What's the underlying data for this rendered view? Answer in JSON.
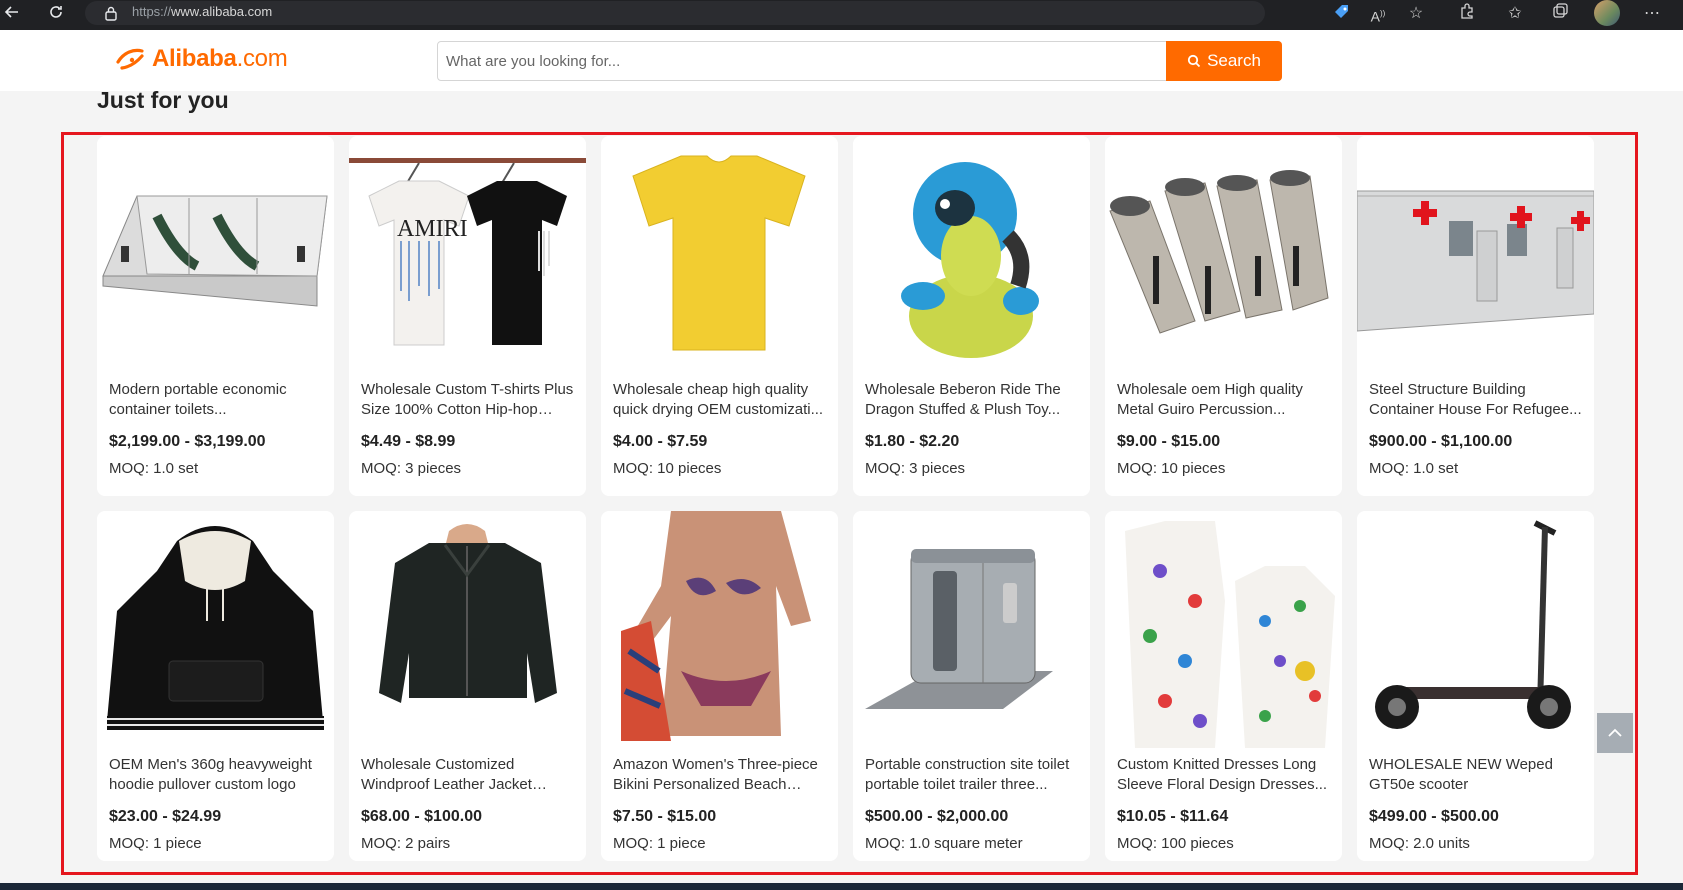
{
  "browser": {
    "url_scheme": "https://",
    "url_host": "www.alibaba.com",
    "icons": [
      "back-icon",
      "reload-icon",
      "lock-icon",
      "tag-icon",
      "read-aloud-icon",
      "favorite-add-icon",
      "extensions-icon",
      "favorites-icon",
      "collections-icon",
      "profile-avatar",
      "more-icon"
    ]
  },
  "header": {
    "logo_text": "Alibaba",
    "logo_suffix": ".com",
    "search_placeholder": "What are you looking for...",
    "search_button": "Search"
  },
  "section": {
    "title": "Just for you"
  },
  "colors": {
    "brand": "#ff6a00",
    "highlight": "#e5161e"
  },
  "products": [
    {
      "title": "Modern portable economic container toilets...",
      "price": "$2,199.00 - $3,199.00",
      "moq": "MOQ: 1.0 set",
      "icon": "container-toilet-image"
    },
    {
      "title": "Wholesale Custom T-shirts Plus Size 100% Cotton Hip-hop Stre...",
      "price": "$4.49 - $8.99",
      "moq": "MOQ: 3 pieces",
      "icon": "tshirts-image"
    },
    {
      "title": "Wholesale cheap high quality quick drying OEM customizati...",
      "price": "$4.00 - $7.59",
      "moq": "MOQ: 10 pieces",
      "icon": "yellow-tshirt-image"
    },
    {
      "title": "Wholesale Beberon Ride The Dragon Stuffed & Plush Toy...",
      "price": "$1.80 - $2.20",
      "moq": "MOQ: 3 pieces",
      "icon": "plush-toy-image"
    },
    {
      "title": "Wholesale oem High quality Metal Guiro Percussion...",
      "price": "$9.00 - $15.00",
      "moq": "MOQ: 10 pieces",
      "icon": "metal-guiro-image"
    },
    {
      "title": "Steel Structure Building Container House For Refugee...",
      "price": "$900.00 - $1,100.00",
      "moq": "MOQ: 1.0 set",
      "icon": "container-house-image"
    },
    {
      "title": "OEM Men's 360g heavyweight hoodie pullover custom logo",
      "price": "$23.00 - $24.99",
      "moq": "MOQ: 1 piece",
      "icon": "hoodie-image"
    },
    {
      "title": "Wholesale Customized Windproof Leather Jacket Men...",
      "price": "$68.00 - $100.00",
      "moq": "MOQ: 2 pairs",
      "icon": "leather-jacket-image"
    },
    {
      "title": "Amazon Women's Three-piece Bikini Personalized Beach Skirt...",
      "price": "$7.50 - $15.00",
      "moq": "MOQ: 1 piece",
      "icon": "bikini-image"
    },
    {
      "title": "Portable construction site toilet portable toilet trailer three...",
      "price": "$500.00 - $2,000.00",
      "moq": "MOQ: 1.0 square meter",
      "icon": "portable-toilet-image"
    },
    {
      "title": "Custom Knitted Dresses Long Sleeve Floral Design Dresses...",
      "price": "$10.05 - $11.64",
      "moq": "MOQ: 100 pieces",
      "icon": "knitted-dress-image"
    },
    {
      "title": "WHOLESALE NEW Weped GT50e scooter",
      "price": "$499.00 - $500.00",
      "moq": "MOQ: 2.0 units",
      "icon": "scooter-image"
    }
  ]
}
